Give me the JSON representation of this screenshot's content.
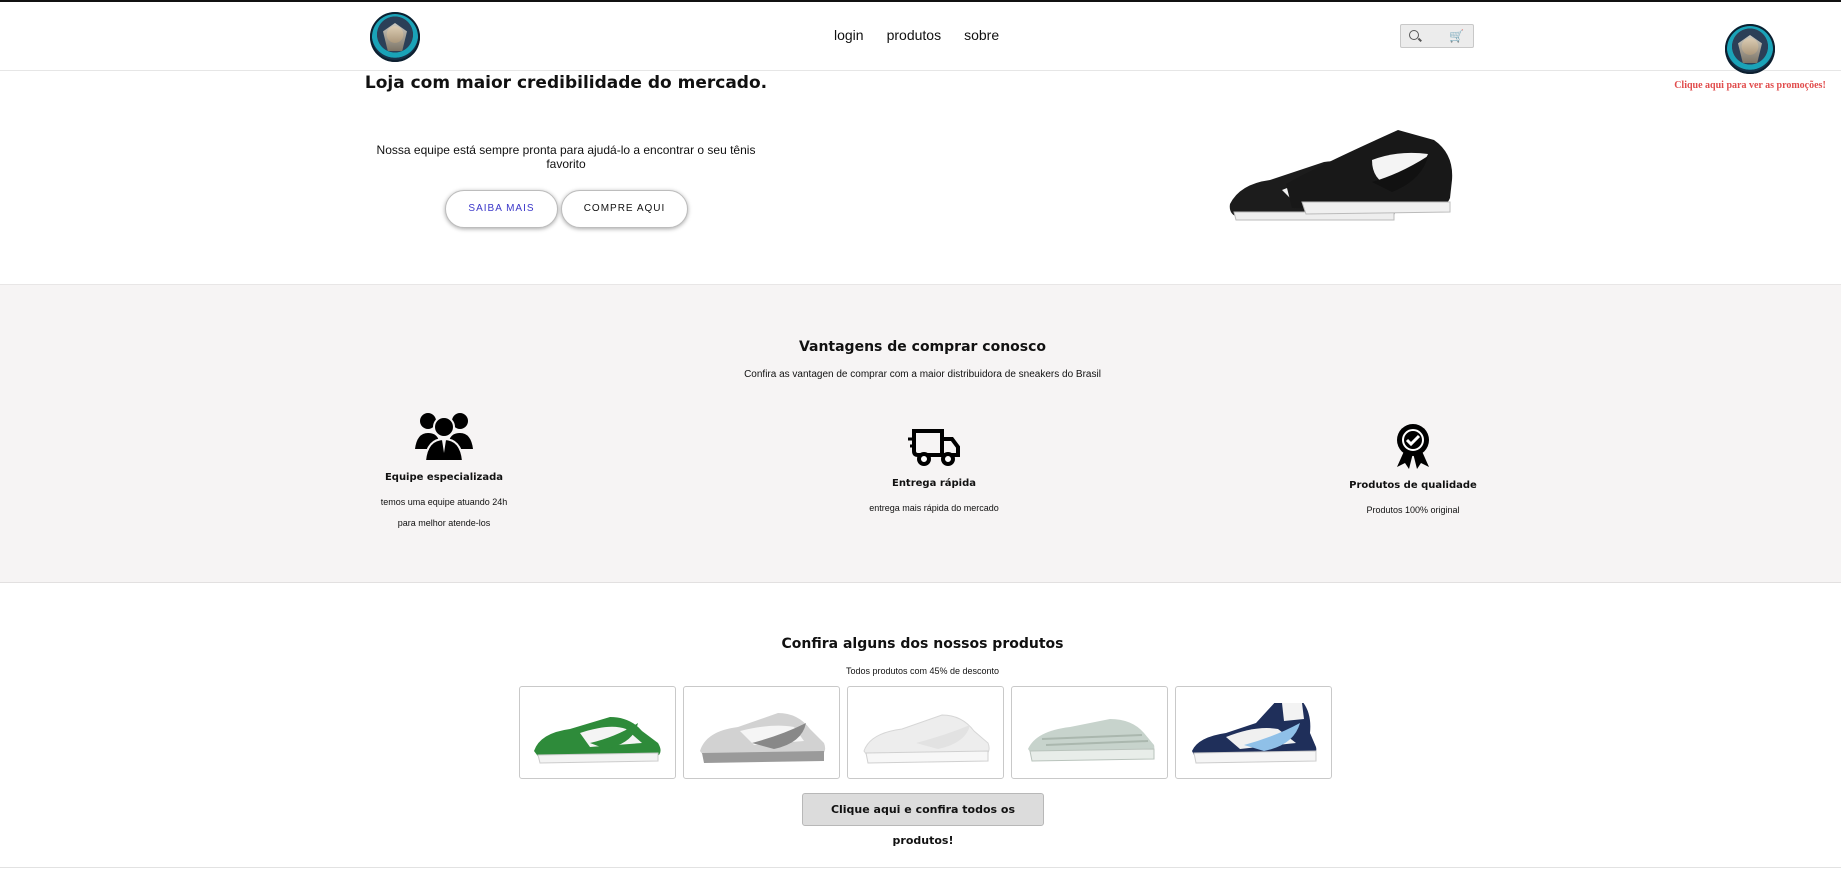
{
  "nav": {
    "links": [
      "login",
      "produtos",
      "sobre"
    ],
    "cart_icon": "🛒"
  },
  "promo": {
    "text": "Clique aqui para ver as promoções!"
  },
  "hero": {
    "title": "Loja com maior credibilidade do mercado.",
    "subtitle": "Nossa equipe está sempre pronta para ajudá-lo a encontrar o seu tênis favorito",
    "btn_saiba": "SAIBA MAIS",
    "btn_compre": "COMPRE AQUI"
  },
  "advantages": {
    "title": "Vantagens de comprar conosco",
    "subtitle": "Confira as vantagen de comprar com a maior distribuidora de sneakers do Brasil",
    "items": [
      {
        "icon": "team-icon",
        "title": "Equipe especializada",
        "desc": "temos uma equipe atuando 24h\npara melhor atende-los"
      },
      {
        "icon": "truck-icon",
        "title": "Entrega rápida",
        "desc": "entrega mais rápida do mercado"
      },
      {
        "icon": "badge-icon",
        "title": "Produtos de qualidade",
        "desc": "Produtos 100% original"
      }
    ]
  },
  "products": {
    "title": "Confira alguns dos nossos produtos",
    "subtitle": "Todos produtos com 45% de desconto",
    "items": [
      {
        "name": "green-dunk",
        "color": "#2e8b3a"
      },
      {
        "name": "grey-air-max-90",
        "color": "#9a9a9a"
      },
      {
        "name": "white-air-force",
        "color": "#e9e9e9"
      },
      {
        "name": "air-max-97",
        "color": "#c7d3cc"
      },
      {
        "name": "jordan-1-navy",
        "color": "#1f2f5a"
      }
    ],
    "all_button": "Clique aqui e confira todos os produtos!"
  },
  "colors": {
    "promo": "#e14c4c",
    "saiba": "#3b37c9",
    "adv_bg": "#f6f4f4"
  }
}
